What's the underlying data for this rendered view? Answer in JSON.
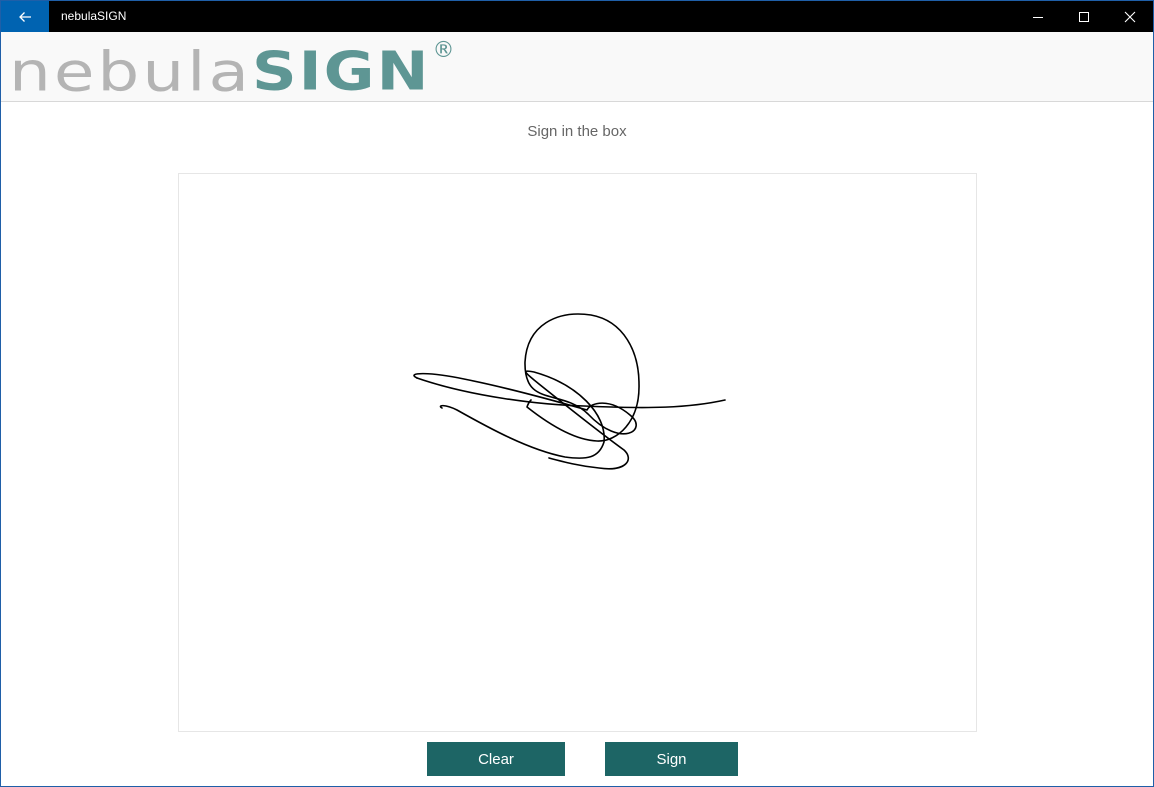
{
  "window": {
    "title": "nebulaSIGN",
    "icons": {
      "back": "arrow-left-icon",
      "minimize": "minimize-icon",
      "maximize": "maximize-icon",
      "close": "close-icon"
    }
  },
  "header": {
    "logo_light": "nebula",
    "logo_bold": "SIGN",
    "logo_mark": "®"
  },
  "instruction": "Sign in the box",
  "signature_pad": {
    "has_signature": true
  },
  "buttons": {
    "clear": "Clear",
    "sign": "Sign"
  },
  "colors": {
    "accent_blue": "#0063b1",
    "button": "#1d6565",
    "logo_gray": "#b4b4b4",
    "logo_teal": "#5e9694"
  }
}
